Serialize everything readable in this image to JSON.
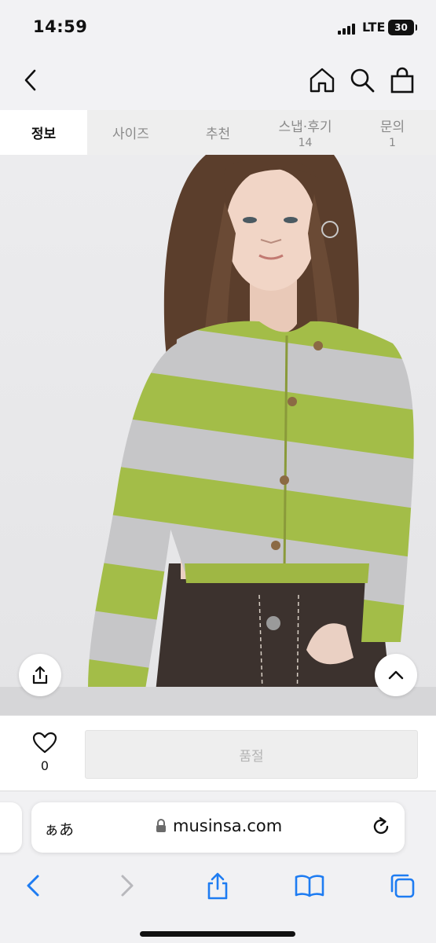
{
  "status_bar": {
    "time": "14:59",
    "network": "LTE",
    "battery": "30"
  },
  "header": {
    "back_icon": "chevron-left-icon",
    "home_icon": "home-icon",
    "search_icon": "search-icon",
    "bag_icon": "shopping-bag-icon"
  },
  "tabs": [
    {
      "label": "정보",
      "count": "",
      "active": true
    },
    {
      "label": "사이즈",
      "count": "",
      "active": false
    },
    {
      "label": "추천",
      "count": "",
      "active": false
    },
    {
      "label": "스냅·후기",
      "count": "14",
      "active": false
    },
    {
      "label": "문의",
      "count": "1",
      "active": false
    }
  ],
  "product": {
    "image": "model wearing green and gray striped cropped cardigan",
    "colors": {
      "green": "#a3bd48",
      "gray": "#c6c6c8"
    }
  },
  "purchase": {
    "like_count": "0",
    "button_label": "품절"
  },
  "browser": {
    "text_size_label": "ぁあ",
    "url": "musinsa.com"
  },
  "colors": {
    "accent_blue": "#1e7cf2",
    "soldout_text": "#b4b4b4"
  }
}
